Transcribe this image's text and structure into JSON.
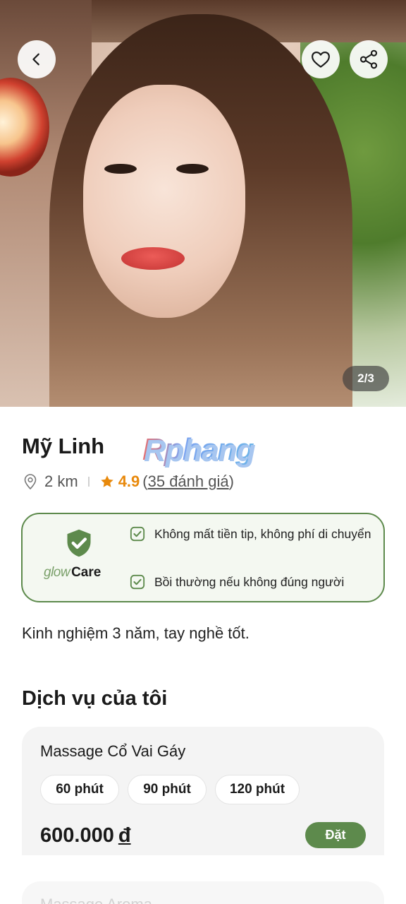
{
  "header": {
    "photo_counter": "2/3",
    "icons": {
      "back": "chevron-left-icon",
      "favorite": "heart-icon",
      "share": "share-icon"
    }
  },
  "profile": {
    "name": "Mỹ Linh",
    "watermark": "Rphang",
    "distance": "2 km",
    "rating": "4.9",
    "reviews_open": "(",
    "reviews_text": "35 đánh giá",
    "reviews_close": ")",
    "bio": "Kinh nghiệm 3 năm, tay nghề tốt."
  },
  "glowcare": {
    "brand_glow": "glow",
    "brand_care": "Care",
    "items": [
      "Không mất tiền tip, không phí di chuyển",
      "Bồi thường nếu không đúng người"
    ]
  },
  "services": {
    "title": "Dịch vụ của tôi",
    "cards": [
      {
        "name": "Massage Cổ Vai Gáy",
        "durations": [
          "60 phút",
          "90 phút",
          "120 phút"
        ],
        "price": "600.000",
        "currency": "đ",
        "book_label": "Đặt"
      },
      {
        "name": "Massage Aroma"
      }
    ]
  },
  "colors": {
    "accent_green": "#5d8a4c",
    "rating_orange": "#e8890c"
  }
}
